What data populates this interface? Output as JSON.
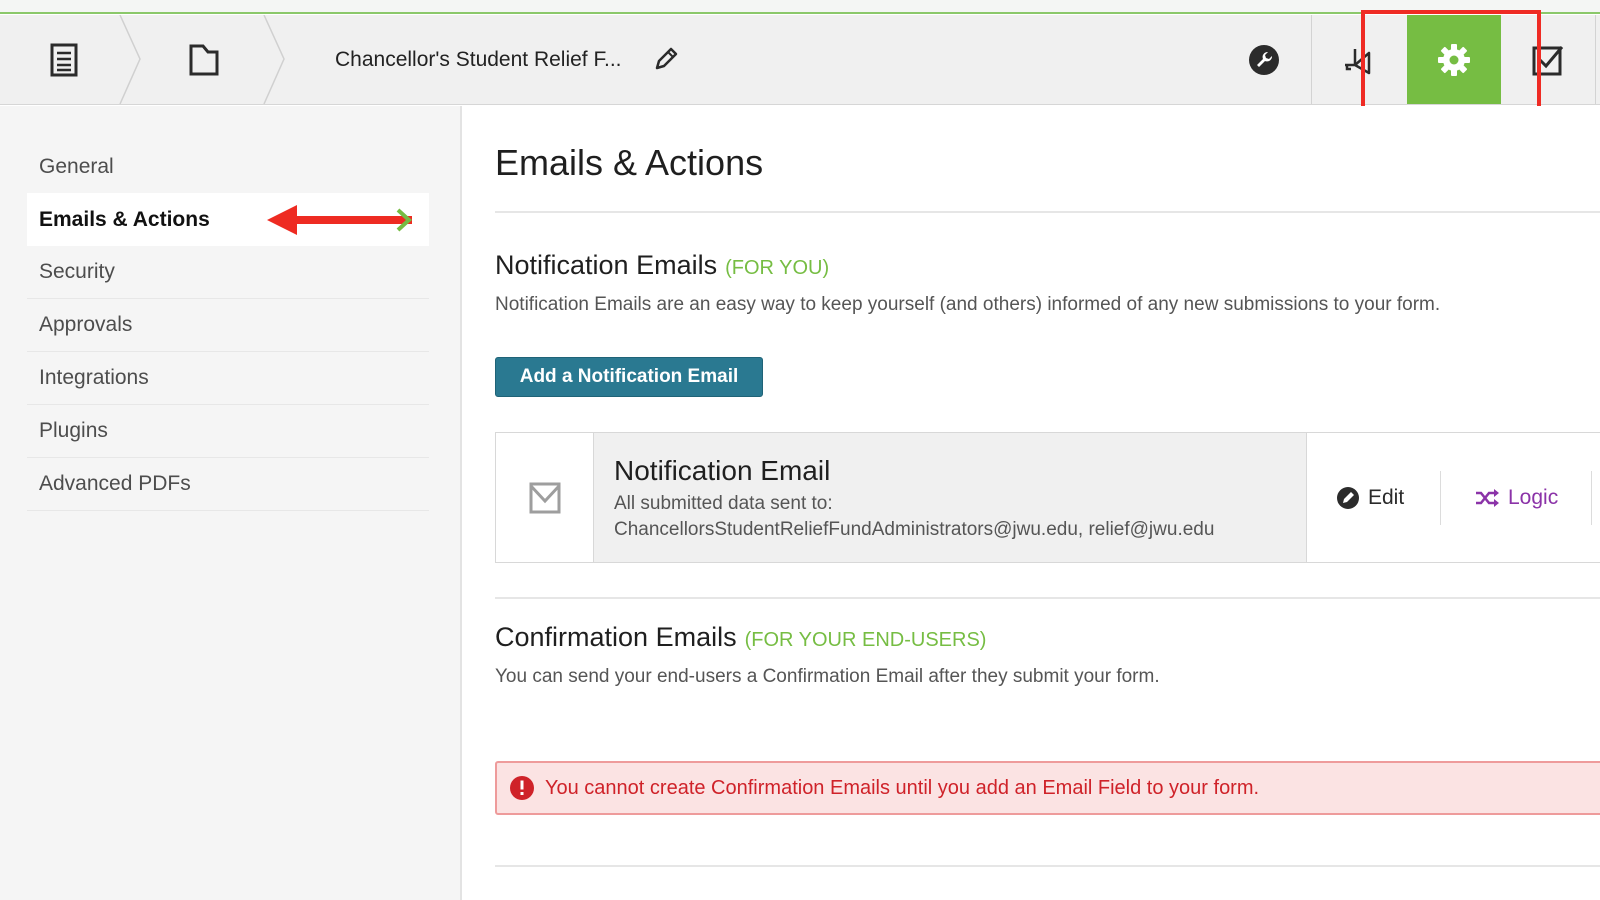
{
  "header": {
    "form_title": "Chancellor's Student Relief F...",
    "icons": [
      "form-icon",
      "folder-icon",
      "pencil-icon",
      "wrench-icon",
      "megaphone-icon",
      "gear-icon",
      "checkbox-icon"
    ],
    "accent_color": "#76bd43",
    "highlight_color": "#ef2b24"
  },
  "sidebar": {
    "items": [
      {
        "label": "General"
      },
      {
        "label": "Emails & Actions",
        "active": true
      },
      {
        "label": "Security"
      },
      {
        "label": "Approvals"
      },
      {
        "label": "Integrations"
      },
      {
        "label": "Plugins"
      },
      {
        "label": "Advanced PDFs"
      }
    ]
  },
  "main": {
    "title": "Emails & Actions",
    "notification": {
      "title": "Notification Emails",
      "tag": "(FOR YOU)",
      "description": "Notification Emails are an easy way to keep yourself (and others) informed of any new submissions to your form.",
      "add_button": "Add a Notification Email",
      "card": {
        "name": "Notification Email",
        "subtitle": "All submitted data sent to:",
        "recipients": "ChancellorsStudentReliefFundAdministrators@jwu.edu, relief@jwu.edu",
        "edit_label": "Edit",
        "logic_label": "Logic"
      }
    },
    "confirmation": {
      "title": "Confirmation Emails",
      "tag": "(FOR YOUR END-USERS)",
      "description": "You can send your end-users a Confirmation Email after they submit your form.",
      "alert": "You cannot create Confirmation Emails until you add an Email Field to your form."
    }
  }
}
